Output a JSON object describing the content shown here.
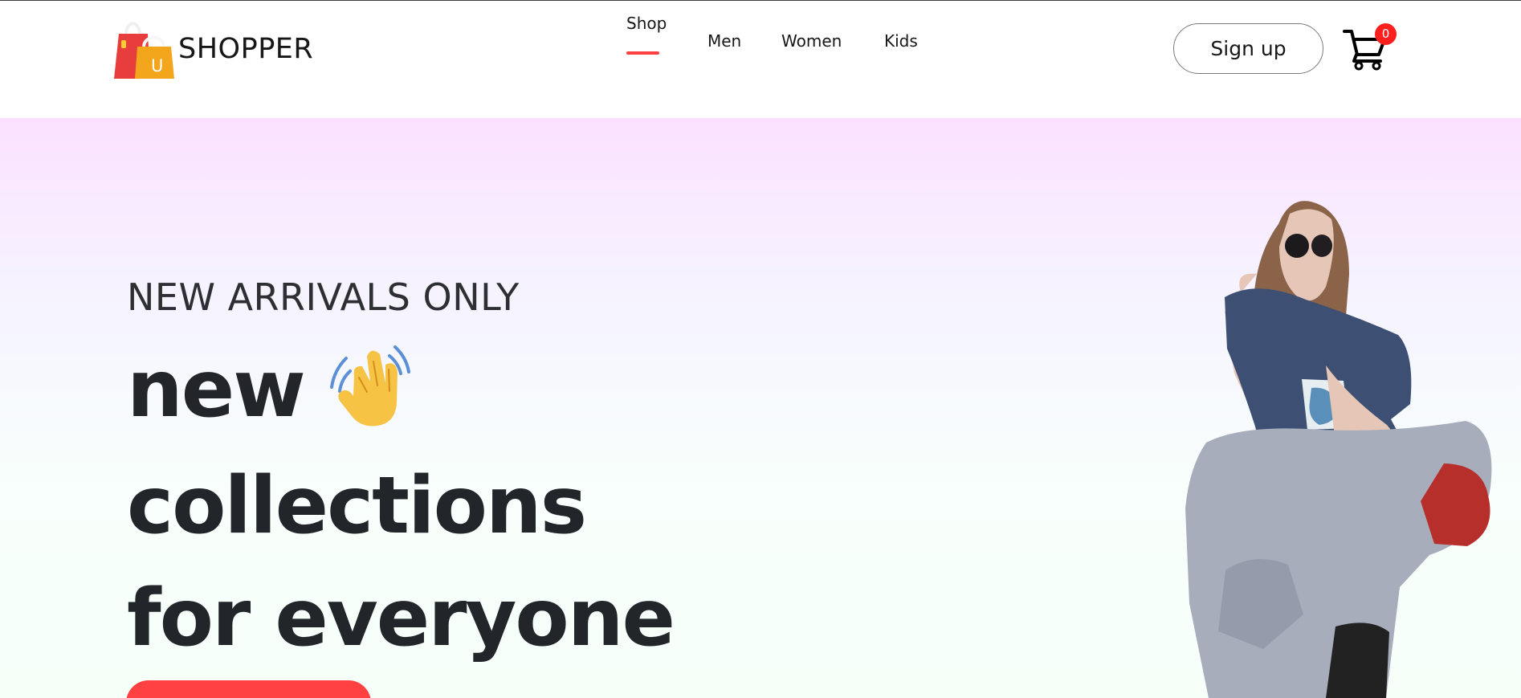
{
  "brand": {
    "name": "SHOPPER"
  },
  "nav": {
    "items": [
      {
        "label": "Shop",
        "active": true
      },
      {
        "label": "Men",
        "active": false
      },
      {
        "label": "Women",
        "active": false
      },
      {
        "label": "Kids",
        "active": false
      }
    ]
  },
  "header": {
    "signup_label": "Sign up",
    "cart_count": "0"
  },
  "hero": {
    "kicker": "NEW ARRIVALS ONLY",
    "line1": "new",
    "line2": "collections",
    "line3": "for everyone",
    "icon": "waving-hand-icon"
  },
  "colors": {
    "accent": "#ff4141",
    "text": "#171717",
    "hero_top": "#fbe1ff",
    "hero_bottom": "#f6fff8"
  }
}
